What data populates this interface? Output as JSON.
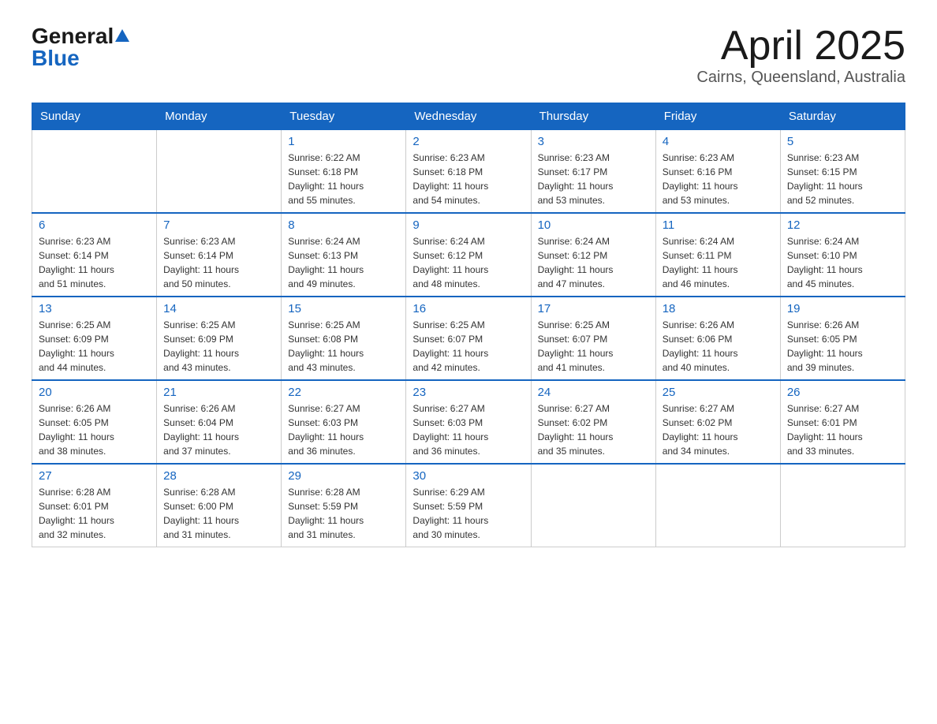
{
  "header": {
    "logo_general": "General",
    "logo_blue": "Blue",
    "month_title": "April 2025",
    "location": "Cairns, Queensland, Australia"
  },
  "calendar": {
    "days_of_week": [
      "Sunday",
      "Monday",
      "Tuesday",
      "Wednesday",
      "Thursday",
      "Friday",
      "Saturday"
    ],
    "weeks": [
      [
        {
          "day": "",
          "info": ""
        },
        {
          "day": "",
          "info": ""
        },
        {
          "day": "1",
          "info": "Sunrise: 6:22 AM\nSunset: 6:18 PM\nDaylight: 11 hours\nand 55 minutes."
        },
        {
          "day": "2",
          "info": "Sunrise: 6:23 AM\nSunset: 6:18 PM\nDaylight: 11 hours\nand 54 minutes."
        },
        {
          "day": "3",
          "info": "Sunrise: 6:23 AM\nSunset: 6:17 PM\nDaylight: 11 hours\nand 53 minutes."
        },
        {
          "day": "4",
          "info": "Sunrise: 6:23 AM\nSunset: 6:16 PM\nDaylight: 11 hours\nand 53 minutes."
        },
        {
          "day": "5",
          "info": "Sunrise: 6:23 AM\nSunset: 6:15 PM\nDaylight: 11 hours\nand 52 minutes."
        }
      ],
      [
        {
          "day": "6",
          "info": "Sunrise: 6:23 AM\nSunset: 6:14 PM\nDaylight: 11 hours\nand 51 minutes."
        },
        {
          "day": "7",
          "info": "Sunrise: 6:23 AM\nSunset: 6:14 PM\nDaylight: 11 hours\nand 50 minutes."
        },
        {
          "day": "8",
          "info": "Sunrise: 6:24 AM\nSunset: 6:13 PM\nDaylight: 11 hours\nand 49 minutes."
        },
        {
          "day": "9",
          "info": "Sunrise: 6:24 AM\nSunset: 6:12 PM\nDaylight: 11 hours\nand 48 minutes."
        },
        {
          "day": "10",
          "info": "Sunrise: 6:24 AM\nSunset: 6:12 PM\nDaylight: 11 hours\nand 47 minutes."
        },
        {
          "day": "11",
          "info": "Sunrise: 6:24 AM\nSunset: 6:11 PM\nDaylight: 11 hours\nand 46 minutes."
        },
        {
          "day": "12",
          "info": "Sunrise: 6:24 AM\nSunset: 6:10 PM\nDaylight: 11 hours\nand 45 minutes."
        }
      ],
      [
        {
          "day": "13",
          "info": "Sunrise: 6:25 AM\nSunset: 6:09 PM\nDaylight: 11 hours\nand 44 minutes."
        },
        {
          "day": "14",
          "info": "Sunrise: 6:25 AM\nSunset: 6:09 PM\nDaylight: 11 hours\nand 43 minutes."
        },
        {
          "day": "15",
          "info": "Sunrise: 6:25 AM\nSunset: 6:08 PM\nDaylight: 11 hours\nand 43 minutes."
        },
        {
          "day": "16",
          "info": "Sunrise: 6:25 AM\nSunset: 6:07 PM\nDaylight: 11 hours\nand 42 minutes."
        },
        {
          "day": "17",
          "info": "Sunrise: 6:25 AM\nSunset: 6:07 PM\nDaylight: 11 hours\nand 41 minutes."
        },
        {
          "day": "18",
          "info": "Sunrise: 6:26 AM\nSunset: 6:06 PM\nDaylight: 11 hours\nand 40 minutes."
        },
        {
          "day": "19",
          "info": "Sunrise: 6:26 AM\nSunset: 6:05 PM\nDaylight: 11 hours\nand 39 minutes."
        }
      ],
      [
        {
          "day": "20",
          "info": "Sunrise: 6:26 AM\nSunset: 6:05 PM\nDaylight: 11 hours\nand 38 minutes."
        },
        {
          "day": "21",
          "info": "Sunrise: 6:26 AM\nSunset: 6:04 PM\nDaylight: 11 hours\nand 37 minutes."
        },
        {
          "day": "22",
          "info": "Sunrise: 6:27 AM\nSunset: 6:03 PM\nDaylight: 11 hours\nand 36 minutes."
        },
        {
          "day": "23",
          "info": "Sunrise: 6:27 AM\nSunset: 6:03 PM\nDaylight: 11 hours\nand 36 minutes."
        },
        {
          "day": "24",
          "info": "Sunrise: 6:27 AM\nSunset: 6:02 PM\nDaylight: 11 hours\nand 35 minutes."
        },
        {
          "day": "25",
          "info": "Sunrise: 6:27 AM\nSunset: 6:02 PM\nDaylight: 11 hours\nand 34 minutes."
        },
        {
          "day": "26",
          "info": "Sunrise: 6:27 AM\nSunset: 6:01 PM\nDaylight: 11 hours\nand 33 minutes."
        }
      ],
      [
        {
          "day": "27",
          "info": "Sunrise: 6:28 AM\nSunset: 6:01 PM\nDaylight: 11 hours\nand 32 minutes."
        },
        {
          "day": "28",
          "info": "Sunrise: 6:28 AM\nSunset: 6:00 PM\nDaylight: 11 hours\nand 31 minutes."
        },
        {
          "day": "29",
          "info": "Sunrise: 6:28 AM\nSunset: 5:59 PM\nDaylight: 11 hours\nand 31 minutes."
        },
        {
          "day": "30",
          "info": "Sunrise: 6:29 AM\nSunset: 5:59 PM\nDaylight: 11 hours\nand 30 minutes."
        },
        {
          "day": "",
          "info": ""
        },
        {
          "day": "",
          "info": ""
        },
        {
          "day": "",
          "info": ""
        }
      ]
    ]
  }
}
